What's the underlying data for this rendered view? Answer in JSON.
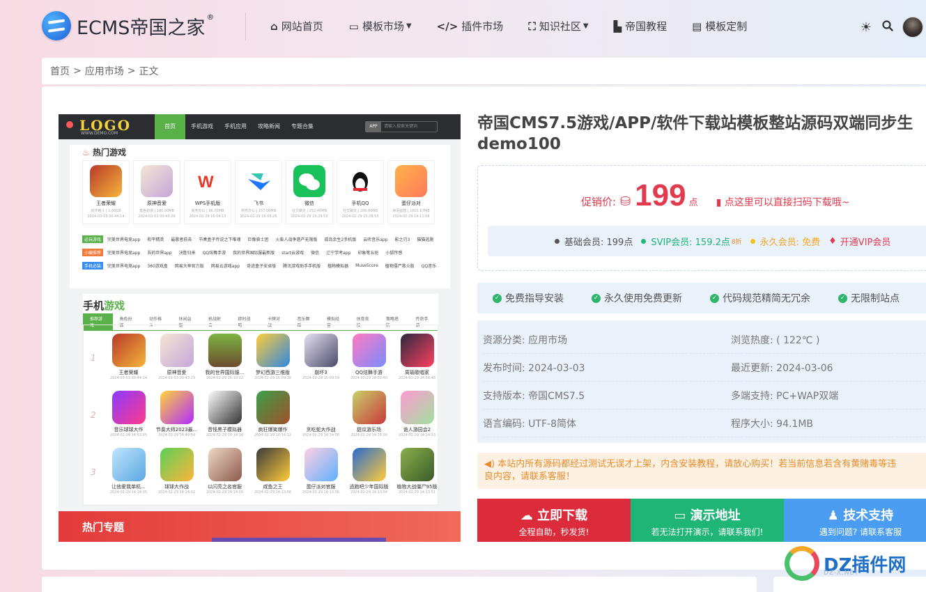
{
  "header": {
    "logo_text": "ECMS帝国之家",
    "logo_reg": "®",
    "nav": [
      {
        "icon": "home-icon",
        "glyph": "⌂",
        "label": "网站首页",
        "caret": false
      },
      {
        "icon": "monitor-icon",
        "glyph": "▭",
        "label": "模板市场",
        "caret": true
      },
      {
        "icon": "code-icon",
        "glyph": "</>",
        "label": "插件市场",
        "caret": false
      },
      {
        "icon": "frame-icon",
        "glyph": "⛶",
        "label": "知识社区",
        "caret": true
      },
      {
        "icon": "book-icon",
        "glyph": "▙",
        "label": "帝国教程",
        "caret": false
      },
      {
        "icon": "file-icon",
        "glyph": "▤",
        "label": "模板定制",
        "caret": false
      }
    ]
  },
  "breadcrumb": {
    "home": "首页",
    "sep": ">",
    "section": "应用市场",
    "current": "正文"
  },
  "preview": {
    "logo": "LOGO",
    "logo_sub": "WWW.DEMO.COM",
    "nav": [
      "首页",
      "手机游戏",
      "手机应用",
      "攻略新闻",
      "专题合集"
    ],
    "search_tag": "APP",
    "search_placeholder": "请输入搜索关键词",
    "hot_title": "热门游戏",
    "hot_apps": [
      {
        "name": "王者荣耀",
        "meta": "动作格斗 | 1.00GB",
        "date": "2024-03-03 00:44:14"
      },
      {
        "name": "原神音爱",
        "meta": "角色扮演 | 180.00MB",
        "date": "2024-03-03 00:43:29"
      },
      {
        "name": "WPS手机版",
        "meta": "商务办公 | 96.00MB",
        "date": "2024-02-29 16:04:13"
      },
      {
        "name": "飞书",
        "meta": "商务办公 | 157.00MB",
        "date": "2024-02-29 16:08:26"
      },
      {
        "name": "微信",
        "meta": "社交聊天 | 252.40MB",
        "date": "2024-02-29 15:29:53"
      },
      {
        "name": "手机QQ",
        "meta": "社交聊天 | 286.00MB",
        "date": "2024-02-29 15:28:53"
      },
      {
        "name": "蛋仔派对",
        "meta": "休闲益智 | 1601.67MB",
        "date": "2024-02-29 14:11:08"
      }
    ],
    "link_rows": [
      {
        "tag": "必玩游戏",
        "color": "#5ab14a",
        "items": [
          "完美世界电竞app",
          "和平精英",
          "最歌者前去",
          "节奏盒子传说之下唯魂",
          "巨像骑士团",
          "火柴人战争遗产无限版",
          "孤岛余生2手机版",
          "云听音乐app",
          "影之刃3",
          "猫猫逃脱"
        ]
      },
      {
        "tag": "小编推荐",
        "color": "#f07a3a",
        "items": [
          "完美世界电竞app",
          "吾的世界app",
          "决胜归来",
          "QQ炫舞手游",
          "我的世界国际服最新版",
          "start云游戏",
          "微信",
          "辽宁学考app",
          "印象笔五班",
          "小狐传感"
        ]
      },
      {
        "tag": "手机必装",
        "color": "#3a8ef0",
        "items": [
          "完美世界电竞app",
          "360游戏盒",
          "网易大神官方版",
          "网易云游戏app",
          "奇迹盒子安卓版",
          "腾讯游戏助手手机版",
          "植物模拟器",
          "MuseScore",
          "植物僵尸救火版",
          "QQ音乐"
        ]
      }
    ],
    "mobile_title_a": "手机",
    "mobile_title_b": "游戏",
    "tabs": [
      "推荐游戏",
      "角色扮演",
      "动作格斗",
      "休闲益智",
      "枪战射击",
      "即时战略",
      "卡牌对战",
      "音乐舞蹈",
      "模拟经营",
      "体育竞技",
      "策略塔防",
      "传奇手游"
    ],
    "game_rows": [
      {
        "num": "1",
        "games": [
          {
            "name": "王者荣耀",
            "date": "2024-03-03 00:44:14"
          },
          {
            "name": "原神音爱",
            "date": "2024-03-03 00:43:29"
          },
          {
            "name": "我的世界国际服...",
            "date": "2024-02-29 15:10:12"
          },
          {
            "name": "梦幻西游三维版",
            "date": "2024-02-29 15:09:35"
          },
          {
            "name": "崩坏3",
            "date": "2024-02-29 15:09:59"
          },
          {
            "name": "QQ炫舞手游",
            "date": "2024-02-29 14:50:40"
          },
          {
            "name": "周瑜歌唱家",
            "date": "2024-02-29 14:58:48"
          }
        ]
      },
      {
        "num": "2",
        "games": [
          {
            "name": "音乐球球大作",
            "date": "2024-02-29 14:53:05"
          },
          {
            "name": "节奏大师2023最...",
            "date": "2024-02-29 14:49:54"
          },
          {
            "name": "音怪黑子模拟器",
            "date": "2024-02-29 14:14:18"
          },
          {
            "name": "疯狂爆笑爆作",
            "date": "2024-02-29 14:14:12"
          },
          {
            "name": "贪吃蛇大作战",
            "date": "2024-02-29 14:14:06"
          },
          {
            "name": "甜瓜游乐场",
            "date": "2024-02-29 14:14:00"
          },
          {
            "name": "诡人游园会2",
            "date": "2024-02-29 14:14:03"
          }
        ]
      },
      {
        "num": "3",
        "games": [
          {
            "name": "让他爱我单机...",
            "date": "2024-02-29 14:14:05"
          },
          {
            "name": "球球大作战",
            "date": "2024-02-29 14:14:02"
          },
          {
            "name": "以闪亮之名官服",
            "date": "2024-02-29 14:14:00"
          },
          {
            "name": "咸鱼之王",
            "date": "2024-02-29 14:13:58"
          },
          {
            "name": "蛋仔派对官服",
            "date": "2024-02-29 14:13:56"
          },
          {
            "name": "逃跑吧少年国际版",
            "date": "2024-02-29 14:13:54"
          },
          {
            "name": "植物大战僵尸95版",
            "date": "2024-02-29 14:13:51"
          }
        ]
      }
    ],
    "banner": "热门专题"
  },
  "product": {
    "title_line1": "帝国CMS7.5游戏/APP/软件下载站模板整站源码双端同步生",
    "title_line2": "demo100",
    "price_label": "促销价:",
    "price": "199",
    "price_unit": "点",
    "scan_text": "点这里可以直接扫码下载哦~",
    "vip": [
      {
        "label": "基础会员: 199点",
        "color": "#555555",
        "dot": "#555555",
        "sup": ""
      },
      {
        "label": "SVIP会员: 159.2点",
        "color": "#1fb576",
        "dot": "#1fb576",
        "sup": "8折"
      },
      {
        "label": "永久会员: 免费",
        "color": "#f5a623",
        "dot": "#f5c023",
        "sup": ""
      },
      {
        "label": "开通VIP会员",
        "color": "#e23b4e",
        "dot": "",
        "sup": ""
      }
    ],
    "features": [
      "免费指导安装",
      "永久使用免费更新",
      "代码规范精简无冗余",
      "无限制站点"
    ],
    "meta": [
      [
        "资源分类: 应用市场",
        "浏览热度: ( 122℃ )"
      ],
      [
        "发布时间: 2024-03-03",
        "最近更新: 2024-03-06"
      ],
      [
        "支持版本: 帝国CMS7.5",
        "多端支持: PC+WAP双端"
      ],
      [
        "语言编码: UTF-8简体",
        "程序大小: 94.1MB"
      ]
    ],
    "notice_line1": "本站内所有源码都经过测试无误才上架，内含安装教程，请放心购买！若当前信息若含有黄赌毒等违",
    "notice_line2": "良内容，请联系客服！",
    "buttons": [
      {
        "title": "立即下载",
        "sub": "全程自助，秒发货!",
        "icon": "☁"
      },
      {
        "title": "演示地址",
        "sub": "若无法打开演示，请联系我们!",
        "icon": "▭"
      },
      {
        "title": "技术支持",
        "sub": "遇到问题? 请联系客服",
        "icon": "♟"
      }
    ]
  },
  "watermark": {
    "text": "DZ插件网",
    "sub": "DZ-X.NET"
  },
  "colors": {
    "accent_red": "#e23b4e",
    "accent_green": "#1fb576",
    "accent_blue": "#4a9df0",
    "panel_blue": "#e9f1fb"
  }
}
